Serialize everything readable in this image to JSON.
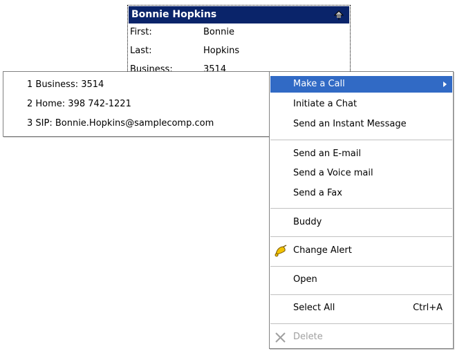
{
  "card": {
    "name": "Bonnie Hopkins",
    "rows": [
      {
        "label": "First:",
        "value": "Bonnie"
      },
      {
        "label": "Last:",
        "value": "Hopkins"
      },
      {
        "label": "Business:",
        "value": "3514"
      }
    ]
  },
  "submenu": {
    "items": [
      "1 Business: 3514",
      "2 Home: 398 742-1221",
      "3 SIP: Bonnie.Hopkins@samplecomp.com"
    ]
  },
  "menu": {
    "make_call": "Make a Call",
    "initiate_chat": "Initiate a Chat",
    "send_im": "Send an Instant Message",
    "send_email": "Send an E-mail",
    "send_voicemail": "Send a Voice mail",
    "send_fax": "Send a Fax",
    "buddy": "Buddy",
    "change_alert": "Change Alert",
    "open": "Open",
    "select_all": "Select All",
    "select_all_shortcut": "Ctrl+A",
    "delete": "Delete"
  },
  "colors": {
    "title_bar": "#0a246a",
    "highlight": "#316ac5",
    "disabled": "#a0a0a0"
  }
}
